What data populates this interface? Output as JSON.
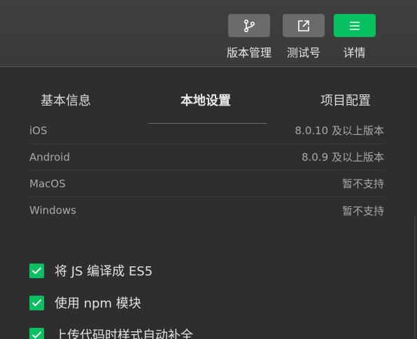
{
  "toolbar": {
    "version_mgmt": {
      "label": "版本管理",
      "icon": "branch-icon"
    },
    "test_account": {
      "label": "测试号",
      "icon": "external-link-icon"
    },
    "details": {
      "label": "详情",
      "icon": "menu-icon"
    }
  },
  "tabs": {
    "basic": "基本信息",
    "local": "本地设置",
    "project": "项目配置",
    "active": "本地设置"
  },
  "versions": [
    {
      "os": "iOS",
      "requirement": "8.0.10 及以上版本"
    },
    {
      "os": "Android",
      "requirement": "8.0.9 及以上版本"
    },
    {
      "os": "MacOS",
      "requirement": "暂不支持"
    },
    {
      "os": "Windows",
      "requirement": "暂不支持"
    }
  ],
  "options": [
    {
      "label": "将 JS 编译成 ES5",
      "checked": true
    },
    {
      "label": "使用 npm 模块",
      "checked": true
    },
    {
      "label": "上传代码时样式自动补全",
      "checked": true
    }
  ],
  "colors": {
    "accent": "#07c160",
    "background": "#2e2e2e",
    "toolbar": "#3d3d3d",
    "button": "#6b6b6b"
  }
}
